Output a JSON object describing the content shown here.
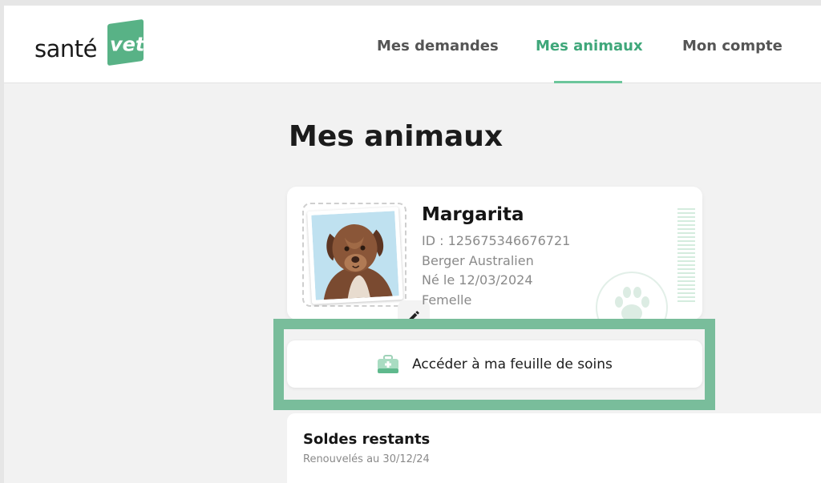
{
  "header": {
    "logo_text": "santé",
    "logo_badge": "vet",
    "nav": [
      {
        "label": "Mes demandes",
        "active": false
      },
      {
        "label": "Mes animaux",
        "active": true
      },
      {
        "label": "Mon compte",
        "active": false
      }
    ]
  },
  "page": {
    "title": "Mes animaux"
  },
  "pet": {
    "name": "Margarita",
    "id_line": "ID : 125675346676721",
    "breed": "Berger Australien",
    "birth": "Né le 12/03/2024",
    "sex": "Femelle"
  },
  "care_sheet": {
    "label": "Accéder à ma feuille de soins"
  },
  "balances": {
    "title": "Soldes restants",
    "subtitle": "Renouvelés au 30/12/24"
  },
  "colors": {
    "brand_green": "#58b286",
    "active_nav": "#3fa77a",
    "highlight": "#79bd9b"
  },
  "icons": [
    "pencil-icon",
    "medical-case-icon",
    "paw-icon"
  ]
}
